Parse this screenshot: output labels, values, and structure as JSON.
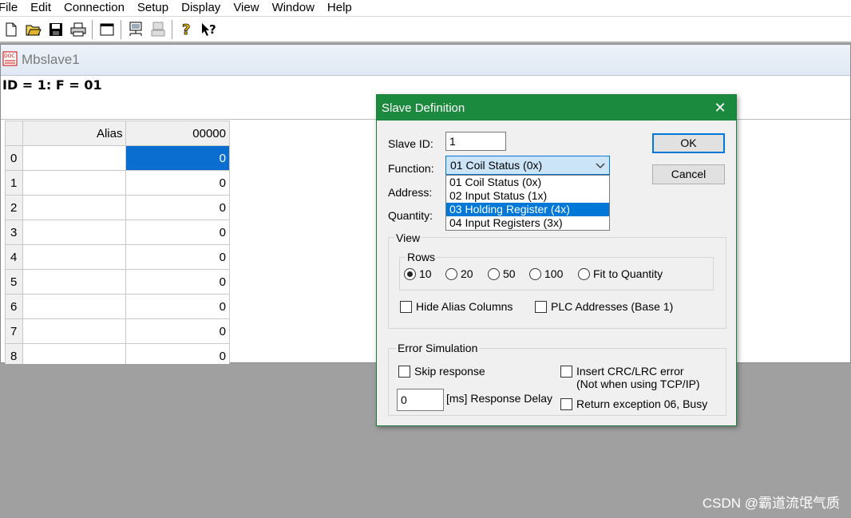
{
  "menu": [
    "File",
    "Edit",
    "Connection",
    "Setup",
    "Display",
    "View",
    "Window",
    "Help"
  ],
  "toolbar_icons": [
    "new-file-icon",
    "open-folder-icon",
    "save-icon",
    "print-icon",
    "window-icon",
    "connect-icon",
    "disconnect-icon",
    "help-icon",
    "context-help-icon"
  ],
  "child": {
    "title": "Mbslave1",
    "id_line": "ID = 1: F = 01"
  },
  "grid": {
    "headers": [
      "Alias",
      "00000"
    ],
    "rows": [
      {
        "index": "0",
        "alias": "",
        "value": "0"
      },
      {
        "index": "1",
        "alias": "",
        "value": "0"
      },
      {
        "index": "2",
        "alias": "",
        "value": "0"
      },
      {
        "index": "3",
        "alias": "",
        "value": "0"
      },
      {
        "index": "4",
        "alias": "",
        "value": "0"
      },
      {
        "index": "5",
        "alias": "",
        "value": "0"
      },
      {
        "index": "6",
        "alias": "",
        "value": "0"
      },
      {
        "index": "7",
        "alias": "",
        "value": "0"
      },
      {
        "index": "8",
        "alias": "",
        "value": "0"
      }
    ]
  },
  "dialog": {
    "title": "Slave Definition",
    "close": "✕",
    "slave_id_label": "Slave ID:",
    "slave_id_value": "1",
    "function_label": "Function:",
    "function_value": "01 Coil Status (0x)",
    "function_options": [
      "01 Coil Status (0x)",
      "02 Input Status (1x)",
      "03 Holding Register (4x)",
      "04 Input Registers (3x)"
    ],
    "address_label": "Address:",
    "quantity_label": "Quantity:",
    "ok_label": "OK",
    "cancel_label": "Cancel",
    "view_label": "View",
    "rows_label": "Rows",
    "rows_options": [
      "10",
      "20",
      "50",
      "100",
      "Fit to Quantity"
    ],
    "hide_alias": "Hide Alias Columns",
    "plc_addresses": "PLC Addresses (Base 1)",
    "error_sim_label": "Error Simulation",
    "skip_response": "Skip response",
    "insert_crc": "Insert CRC/LRC error",
    "insert_crc_note": "(Not when using TCP/IP)",
    "response_delay_value": "0",
    "response_delay_label": "[ms] Response Delay",
    "return_exception": "Return exception 06, Busy"
  },
  "watermark": "CSDN @霸道流氓气质"
}
